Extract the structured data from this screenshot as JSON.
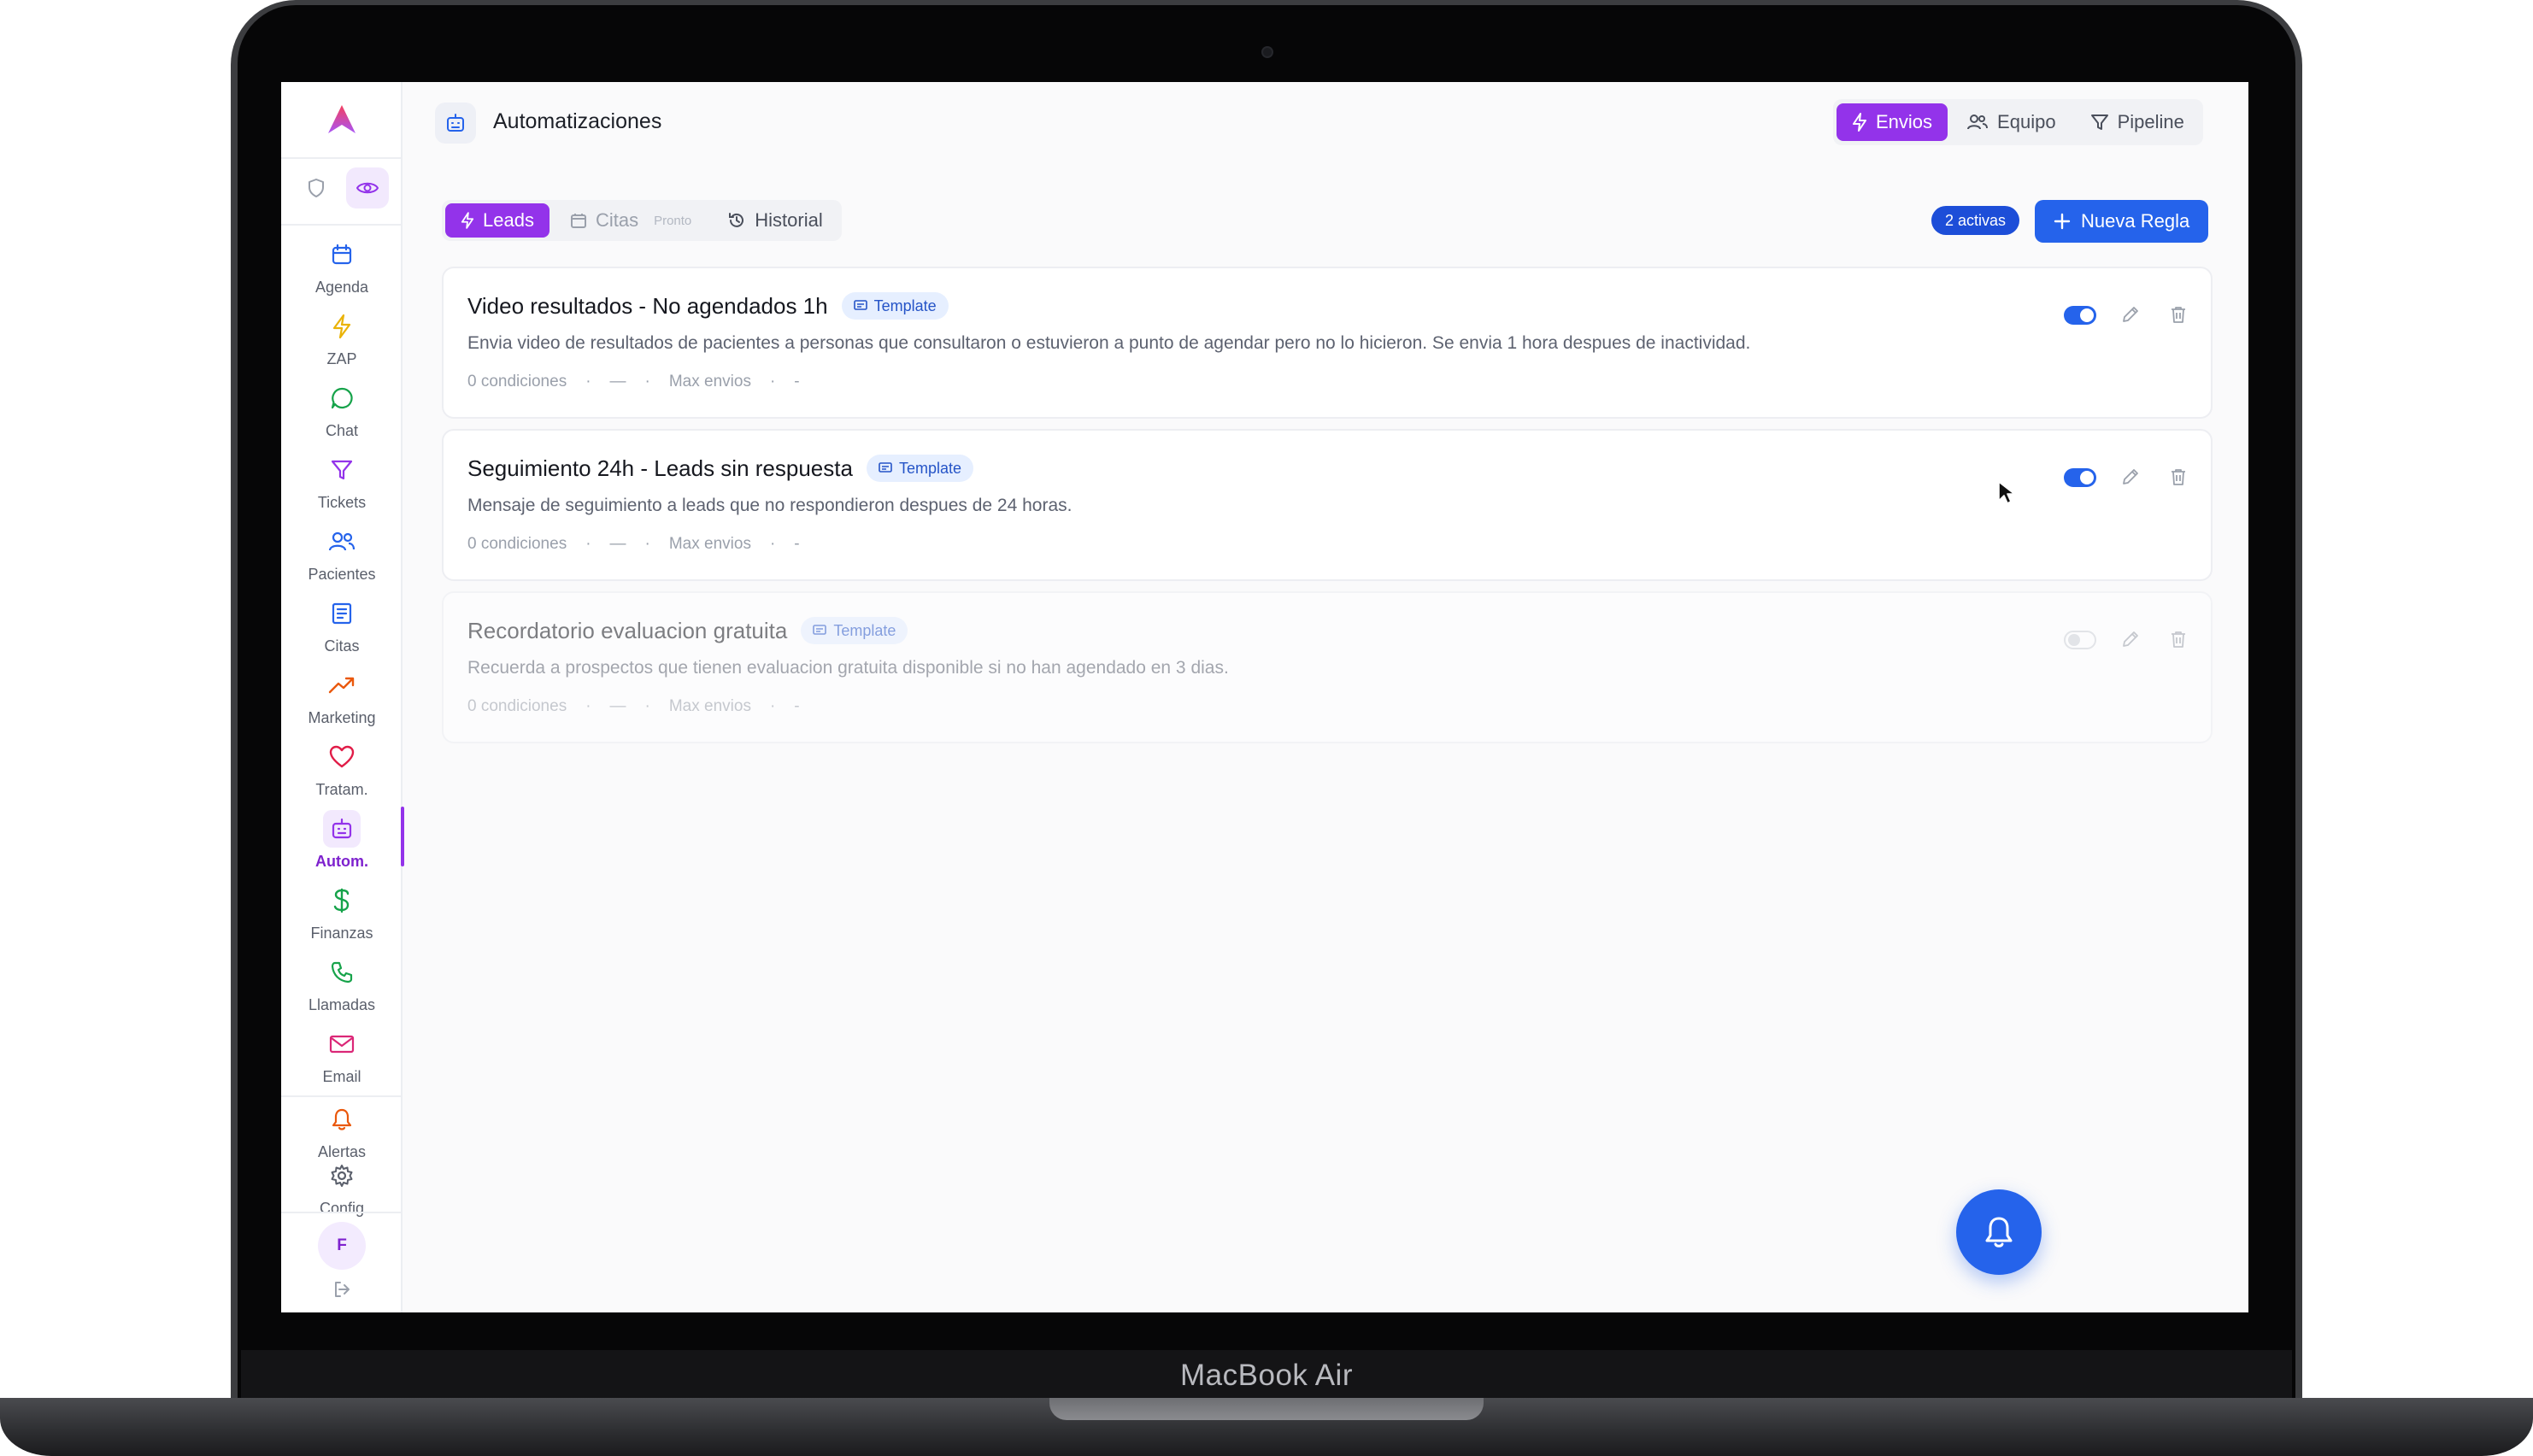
{
  "device": {
    "label": "MacBook Air"
  },
  "app": {
    "page_title": "Automatizaciones"
  },
  "top_nav": [
    {
      "label": "Envios",
      "icon": "zap-icon",
      "active": true
    },
    {
      "label": "Equipo",
      "icon": "users-icon",
      "active": false
    },
    {
      "label": "Pipeline",
      "icon": "filter-icon",
      "active": false
    }
  ],
  "sidebar": {
    "items": [
      {
        "label": "Agenda",
        "icon": "calendar-icon",
        "color": "#2563eb"
      },
      {
        "label": "ZAP",
        "icon": "zap-icon",
        "color": "#eab308"
      },
      {
        "label": "Chat",
        "icon": "chat-icon",
        "color": "#16a34a"
      },
      {
        "label": "Tickets",
        "icon": "filter-icon",
        "color": "#9333ea"
      },
      {
        "label": "Pacientes",
        "icon": "users-icon",
        "color": "#2563eb"
      },
      {
        "label": "Citas",
        "icon": "list-icon",
        "color": "#2563eb"
      },
      {
        "label": "Marketing",
        "icon": "trending-up-icon",
        "color": "#ea580c"
      },
      {
        "label": "Tratam.",
        "icon": "heart-icon",
        "color": "#e11d48"
      },
      {
        "label": "Autom.",
        "icon": "robot-icon",
        "color": "#9333ea",
        "active": true
      },
      {
        "label": "Finanzas",
        "icon": "dollar-icon",
        "color": "#16a34a"
      },
      {
        "label": "Llamadas",
        "icon": "phone-icon",
        "color": "#16a34a"
      },
      {
        "label": "Email",
        "icon": "mail-icon",
        "color": "#db2777"
      }
    ],
    "bottom": [
      {
        "label": "Alertas",
        "icon": "bell-icon",
        "color": "#ea580c"
      },
      {
        "label": "Config",
        "icon": "gear-icon",
        "color": "#5a5f6b"
      }
    ],
    "avatar_initial": "F"
  },
  "tabs": [
    {
      "label": "Leads",
      "icon": "zap-icon",
      "active": true
    },
    {
      "label": "Citas",
      "sublabel": "Pronto",
      "icon": "calendar-icon",
      "disabled": true
    },
    {
      "label": "Historial",
      "icon": "history-icon"
    }
  ],
  "active_count": "2 activas",
  "new_rule_label": "Nueva Regla",
  "rules": [
    {
      "title": "Video resultados - No agendados 1h",
      "badge": "Template",
      "description": "Envia video de resultados de pacientes a personas que consultaron o estuvieron a punto de agendar pero no lo hicieron. Se envia 1 hora despues de inactividad.",
      "conditions": "0 condiciones",
      "dash": "—",
      "max_label": "Max envios",
      "max_value": "-",
      "enabled": true
    },
    {
      "title": "Seguimiento 24h - Leads sin respuesta",
      "badge": "Template",
      "description": "Mensaje de seguimiento a leads que no respondieron despues de 24 horas.",
      "conditions": "0 condiciones",
      "dash": "—",
      "max_label": "Max envios",
      "max_value": "-",
      "enabled": true
    },
    {
      "title": "Recordatorio evaluacion gratuita",
      "badge": "Template",
      "description": "Recuerda a prospectos que tienen evaluacion gratuita disponible si no han agendado en 3 dias.",
      "conditions": "0 condiciones",
      "dash": "—",
      "max_label": "Max envios",
      "max_value": "-",
      "enabled": false
    }
  ]
}
